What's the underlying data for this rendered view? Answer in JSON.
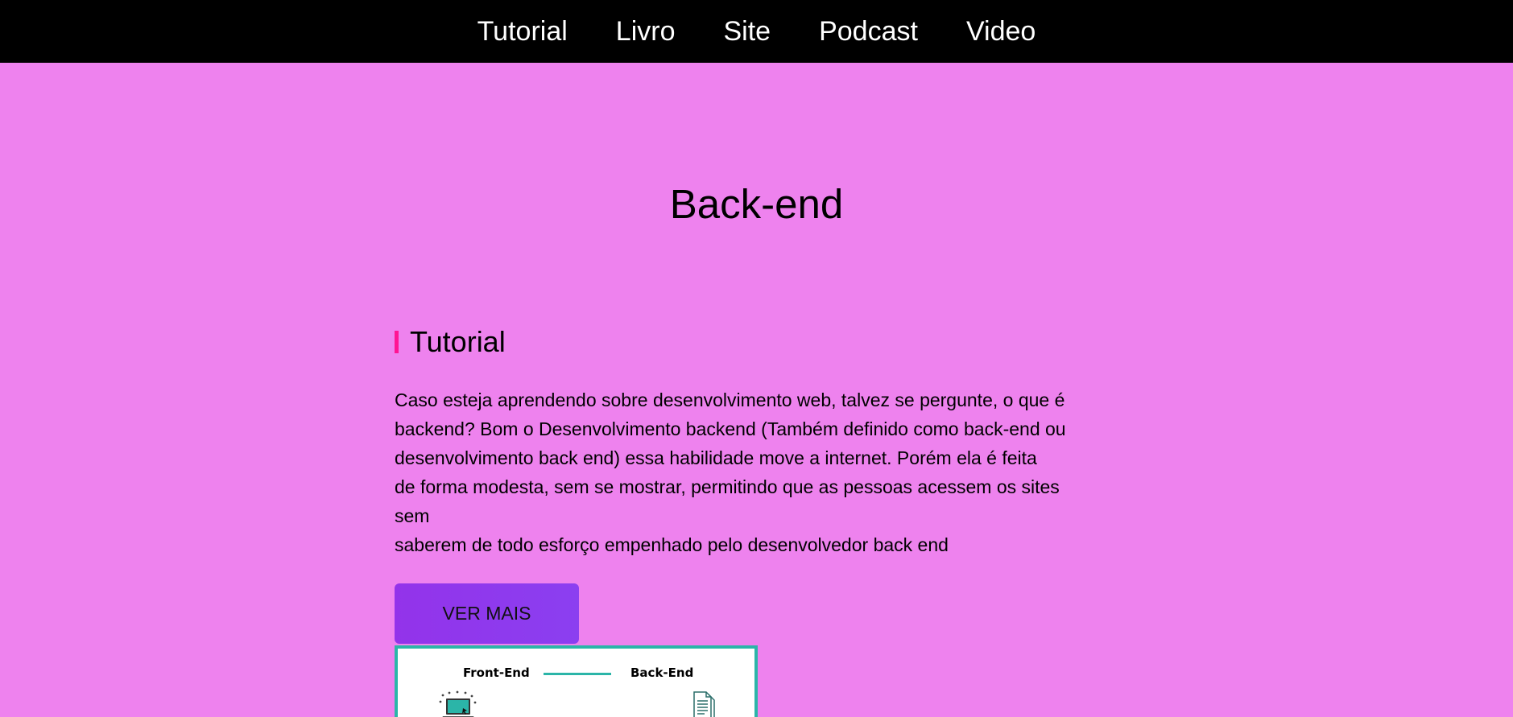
{
  "nav": {
    "items": [
      "Tutorial",
      "Livro",
      "Site",
      "Podcast",
      "Video"
    ]
  },
  "page": {
    "title": "Back-end"
  },
  "section": {
    "heading": "Tutorial",
    "lines": [
      "Caso esteja aprendendo sobre desenvolvimento web, talvez se pergunte, o que é",
      "backend? Bom o Desenvolvimento backend (Também definido como back-end ou",
      "desenvolvimento back end) essa habilidade move a internet. Porém ela é feita",
      "de forma modesta, sem se mostrar, permitindo que as pessoas acessem os sites",
      "sem",
      "saberem de todo esforço empenhado pelo desenvolvedor back end"
    ],
    "button_label": "VER MAIS"
  },
  "diagram": {
    "left_label": "Front-End",
    "right_label": "Back-End",
    "left_icon": "laptop-icon",
    "right_icon": "document-icon"
  },
  "colors": {
    "background": "#ee82ee",
    "nav_background": "#000000",
    "heading_accent": "#ff1493",
    "button": "#9333ea",
    "diagram_border": "#2bb5a8"
  }
}
